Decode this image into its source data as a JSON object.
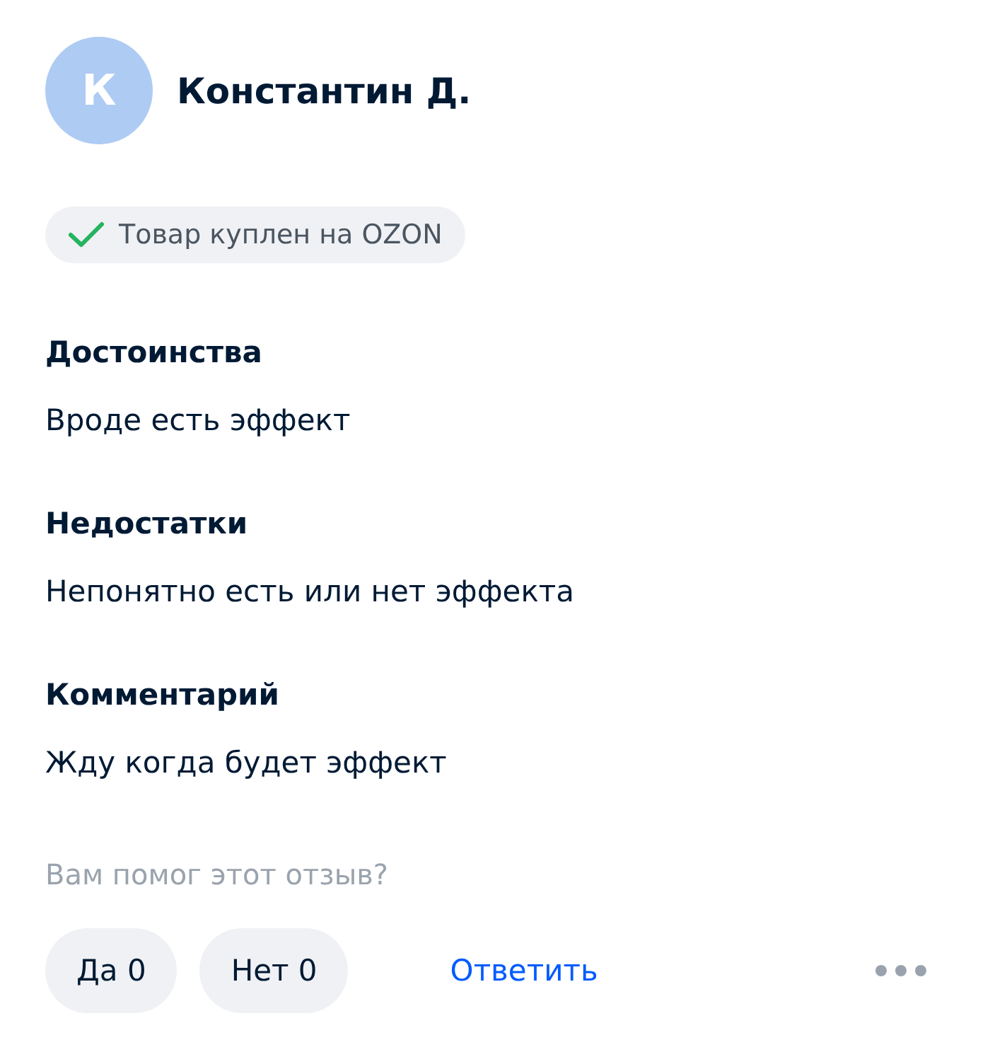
{
  "author": {
    "initial": "К",
    "name": "Константин Д."
  },
  "badge": {
    "text": "Товар куплен на OZON"
  },
  "sections": [
    {
      "title": "Достоинства",
      "text": "Вроде есть эффект"
    },
    {
      "title": "Недостатки",
      "text": "Непонятно есть или нет эффекта"
    },
    {
      "title": "Комментарий",
      "text": "Жду когда будет эффект"
    }
  ],
  "helpful": {
    "question": "Вам помог этот отзыв?",
    "votes": [
      {
        "label": "Да 0"
      },
      {
        "label": "Нет 0"
      }
    ]
  },
  "reply": "Ответить"
}
